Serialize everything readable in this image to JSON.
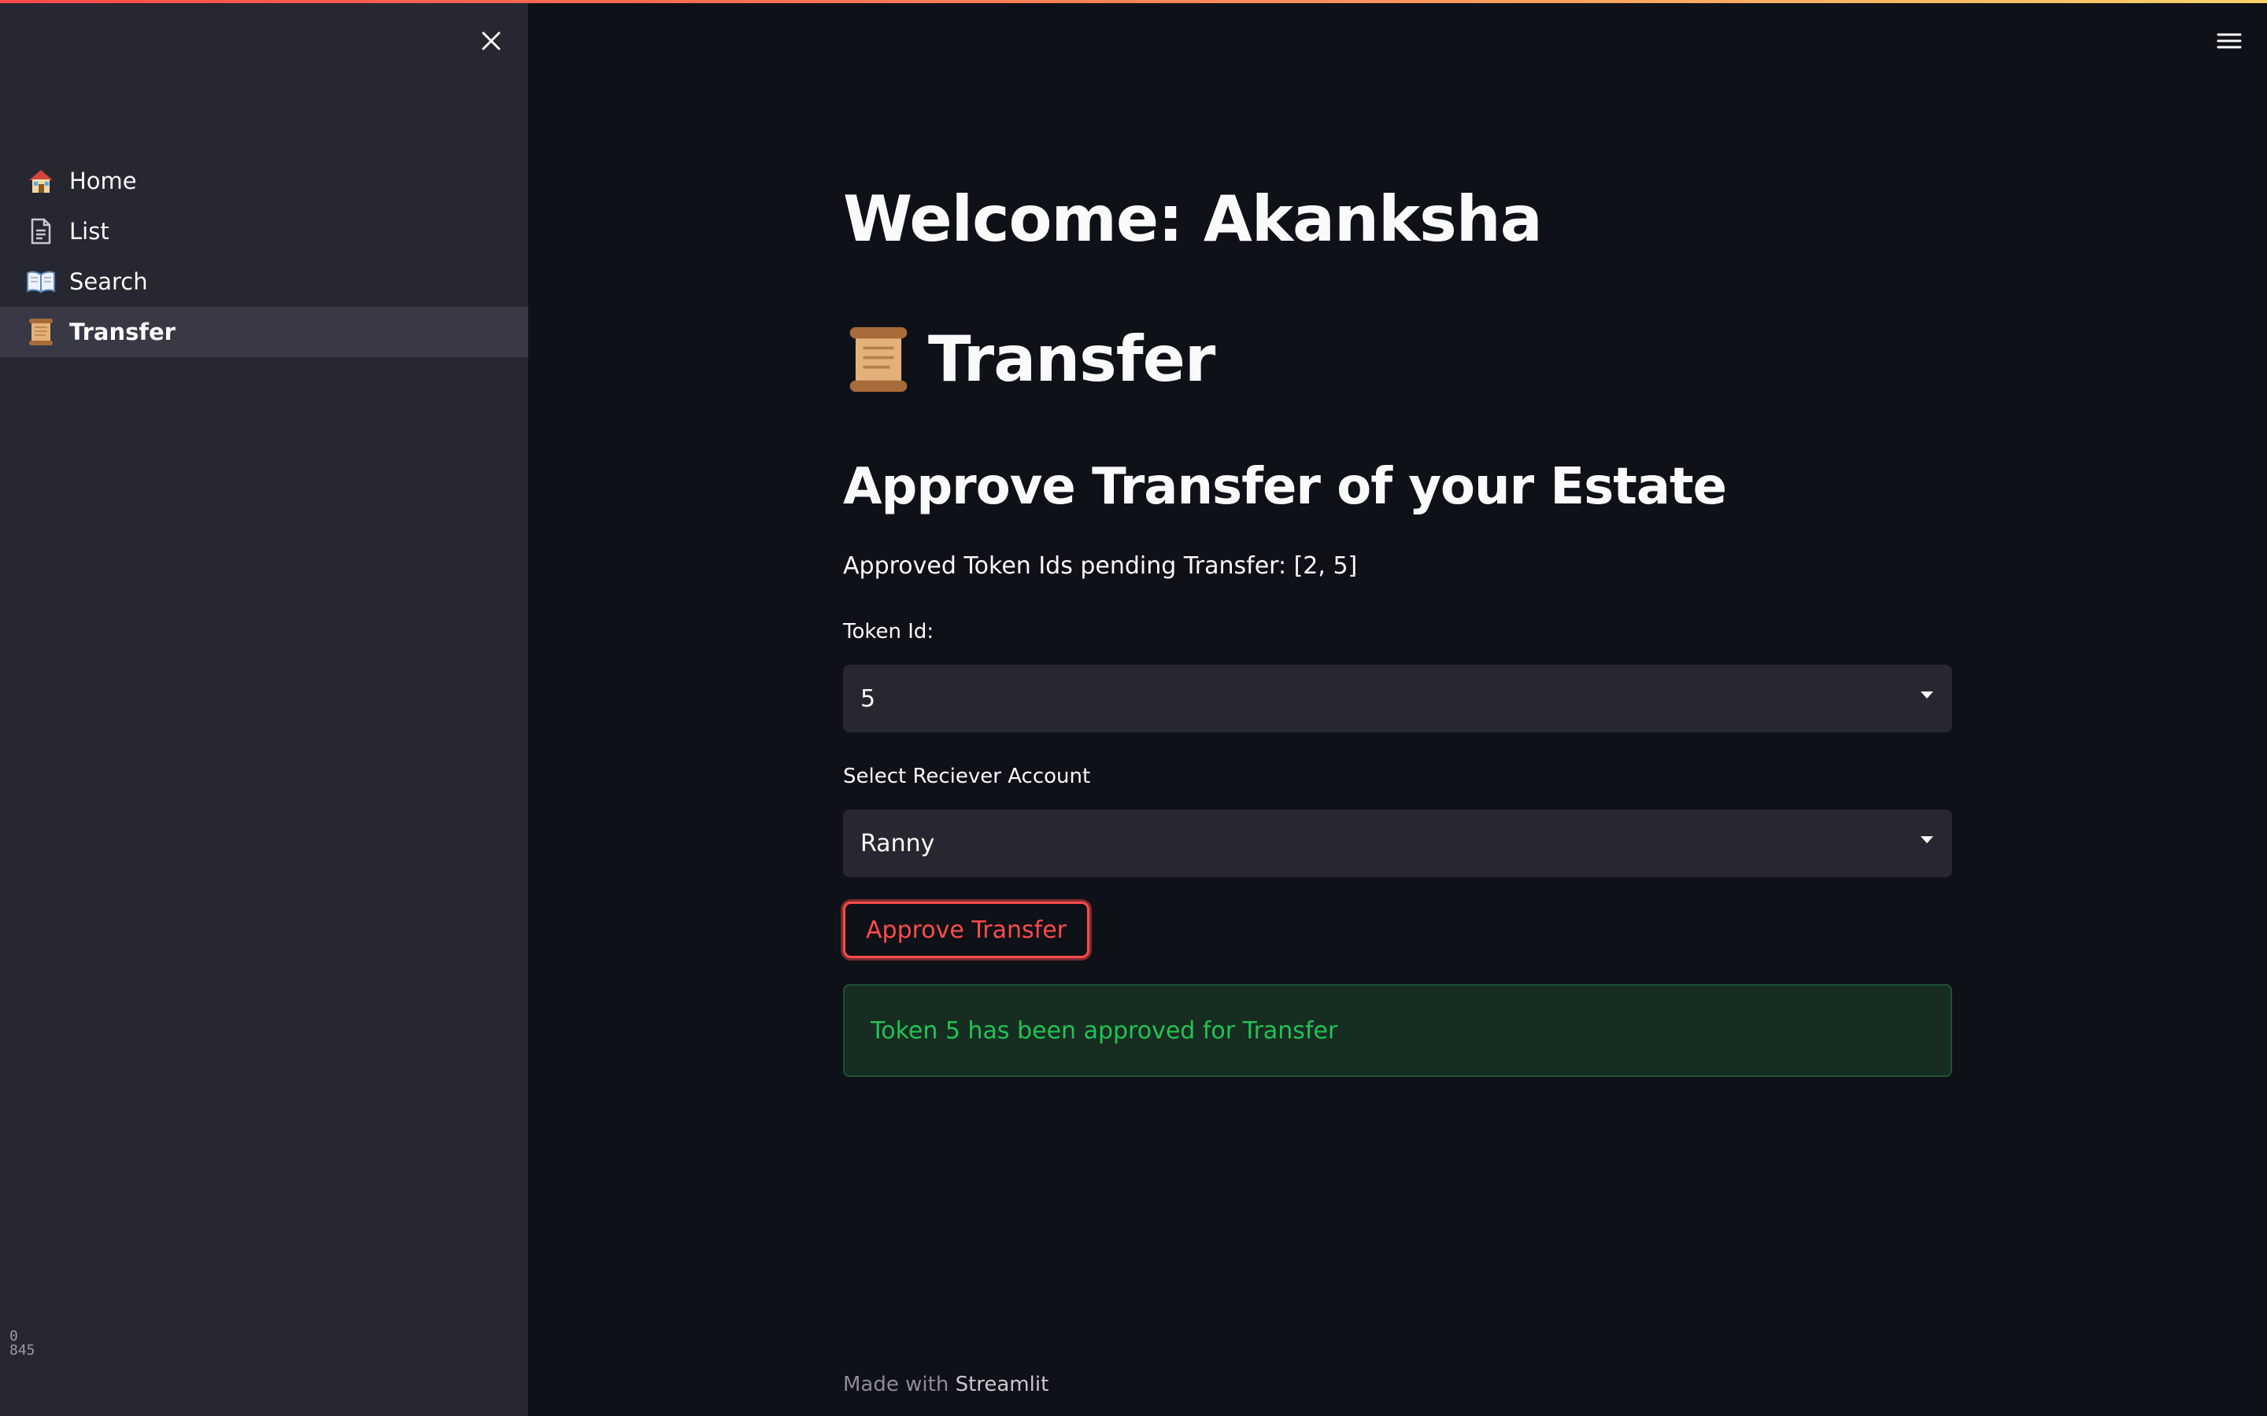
{
  "colors": {
    "background": "#0e1117",
    "sidebar": "#262730",
    "accent": "#ff4b4b",
    "success_text": "#21c354",
    "success_bg": "#172d22"
  },
  "sidebar": {
    "close_icon": "close-icon",
    "items": [
      {
        "label": "Home",
        "icon": "house-icon",
        "active": false
      },
      {
        "label": "List",
        "icon": "document-icon",
        "active": false
      },
      {
        "label": "Search",
        "icon": "open-book-icon",
        "active": false
      },
      {
        "label": "Transfer",
        "icon": "scroll-icon",
        "active": true
      }
    ],
    "corner_text_line1": "0",
    "corner_text_line2": "845"
  },
  "header": {
    "menu_icon": "hamburger-menu-icon"
  },
  "main": {
    "welcome": "Welcome: Akanksha",
    "page_title": "Transfer",
    "page_icon": "scroll-icon",
    "subtitle": "Approve Transfer of your Estate",
    "pending_text": "Approved Token Ids pending Transfer: [2, 5]",
    "token_label": "Token Id:",
    "token_value": "5",
    "receiver_label": "Select Reciever Account",
    "receiver_value": "Ranny",
    "approve_button": "Approve Transfer",
    "success_message": "Token 5 has been approved for Transfer"
  },
  "footer": {
    "prefix": "Made with",
    "brand": "Streamlit"
  }
}
